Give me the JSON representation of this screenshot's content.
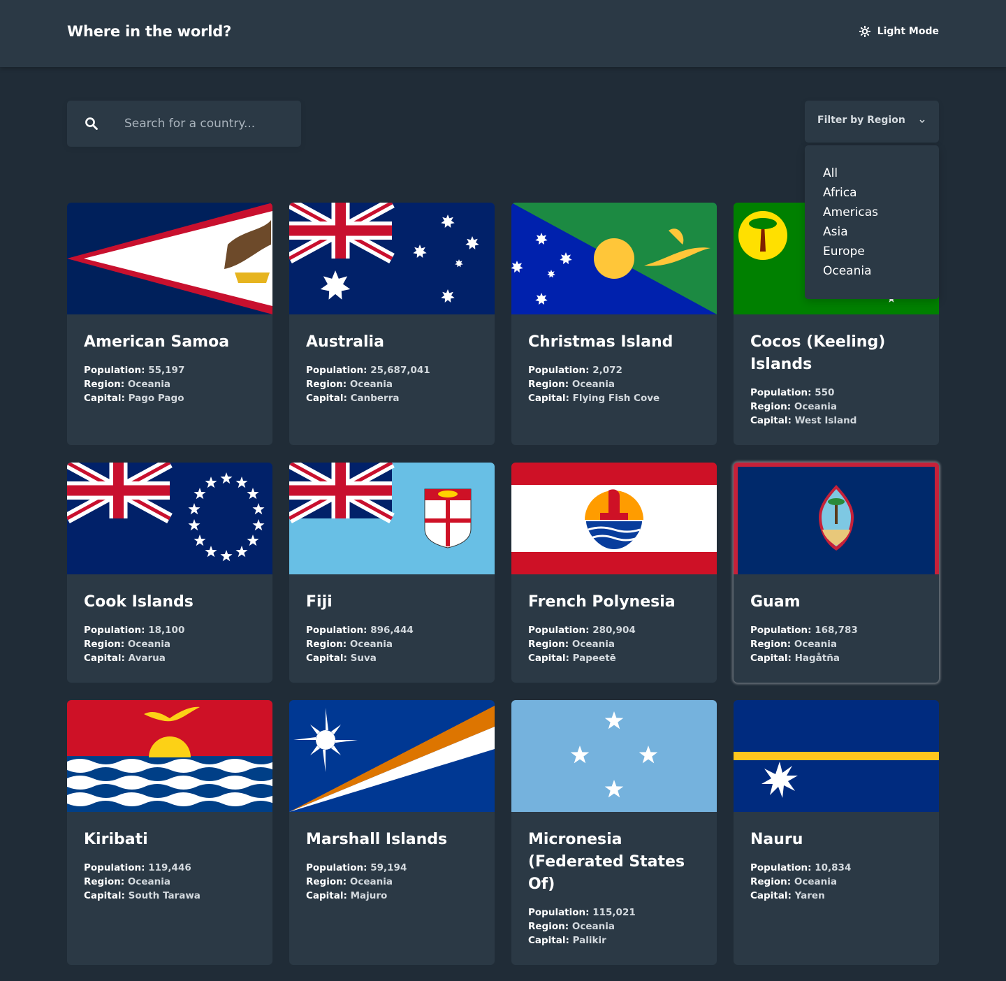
{
  "header": {
    "title": "Where in the world?",
    "theme_toggle_label": "Light Mode",
    "theme_icon": "sun-icon"
  },
  "search": {
    "placeholder": "Search for a country...",
    "value": "",
    "icon": "search-icon"
  },
  "filter": {
    "label": "Filter by Region",
    "icon": "chevron-down-icon",
    "options": [
      "All",
      "Africa",
      "Americas",
      "Asia",
      "Europe",
      "Oceania"
    ]
  },
  "labels": {
    "population": "Population:",
    "region": "Region:",
    "capital": "Capital:"
  },
  "countries": [
    {
      "name": "American Samoa",
      "population": "55,197",
      "region": "Oceania",
      "capital": "Pago Pago"
    },
    {
      "name": "Australia",
      "population": "25,687,041",
      "region": "Oceania",
      "capital": "Canberra"
    },
    {
      "name": "Christmas Island",
      "population": "2,072",
      "region": "Oceania",
      "capital": "Flying Fish Cove"
    },
    {
      "name": "Cocos (Keeling) Islands",
      "population": "550",
      "region": "Oceania",
      "capital": "West Island"
    },
    {
      "name": "Cook Islands",
      "population": "18,100",
      "region": "Oceania",
      "capital": "Avarua"
    },
    {
      "name": "Fiji",
      "population": "896,444",
      "region": "Oceania",
      "capital": "Suva"
    },
    {
      "name": "French Polynesia",
      "population": "280,904",
      "region": "Oceania",
      "capital": "Papeetē"
    },
    {
      "name": "Guam",
      "population": "168,783",
      "region": "Oceania",
      "capital": "Hagåtña"
    },
    {
      "name": "Kiribati",
      "population": "119,446",
      "region": "Oceania",
      "capital": "South Tarawa"
    },
    {
      "name": "Marshall Islands",
      "population": "59,194",
      "region": "Oceania",
      "capital": "Majuro"
    },
    {
      "name": "Micronesia (Federated States Of)",
      "population": "115,021",
      "region": "Oceania",
      "capital": "Palikir"
    },
    {
      "name": "Nauru",
      "population": "10,834",
      "region": "Oceania",
      "capital": "Yaren"
    }
  ],
  "colors": {
    "background": "#202c37",
    "element": "#2b3945",
    "text": "#ffffff"
  }
}
